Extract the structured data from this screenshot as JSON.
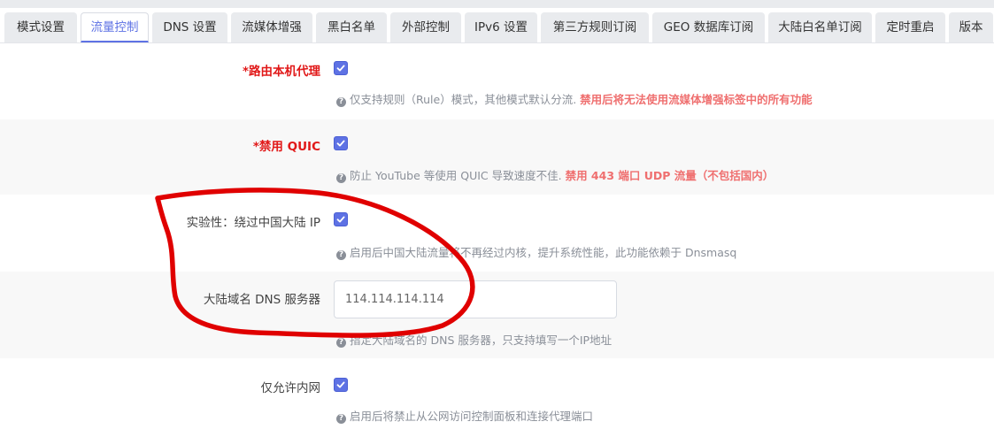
{
  "tabs": [
    {
      "label": "模式设置"
    },
    {
      "label": "流量控制",
      "active": true
    },
    {
      "label": "DNS 设置"
    },
    {
      "label": "流媒体增强"
    },
    {
      "label": "黑白名单"
    },
    {
      "label": "外部控制"
    },
    {
      "label": "IPv6 设置"
    },
    {
      "label": "第三方规则订阅"
    },
    {
      "label": "GEO 数据库订阅"
    },
    {
      "label": "大陆白名单订阅"
    },
    {
      "label": "定时重启"
    },
    {
      "label": "版本"
    }
  ],
  "settings": {
    "route_local_proxy": {
      "label": "*路由本机代理",
      "checked": true,
      "help": "仅支持规则（Rule）模式，其他模式默认分流. ",
      "help_warn": "禁用后将无法使用流媒体增强标签中的所有功能"
    },
    "disable_quic": {
      "label": "*禁用 QUIC",
      "checked": true,
      "help": "防止 YouTube 等使用 QUIC 导致速度不佳. ",
      "help_warn": "禁用 443 端口 UDP 流量（不包括国内）"
    },
    "bypass_china_ip": {
      "label": "实验性：绕过中国大陆 IP",
      "checked": true,
      "help": "启用后中国大陆流量将不再经过内核，提升系统性能，此功能依赖于 Dnsmasq"
    },
    "china_dns_server": {
      "label": "大陆域名 DNS 服务器",
      "value": "114.114.114.114",
      "help": "指定大陆域名的 DNS 服务器，只支持填写一个IP地址"
    },
    "lan_only": {
      "label": "仅允许内网",
      "checked": true,
      "help": "启用后将禁止从公网访问控制面板和连接代理端口"
    }
  },
  "colors": {
    "accent": "#5e72e4",
    "required": "#e11919",
    "warn": "#ef6f6f",
    "annotation": "#e00000"
  }
}
